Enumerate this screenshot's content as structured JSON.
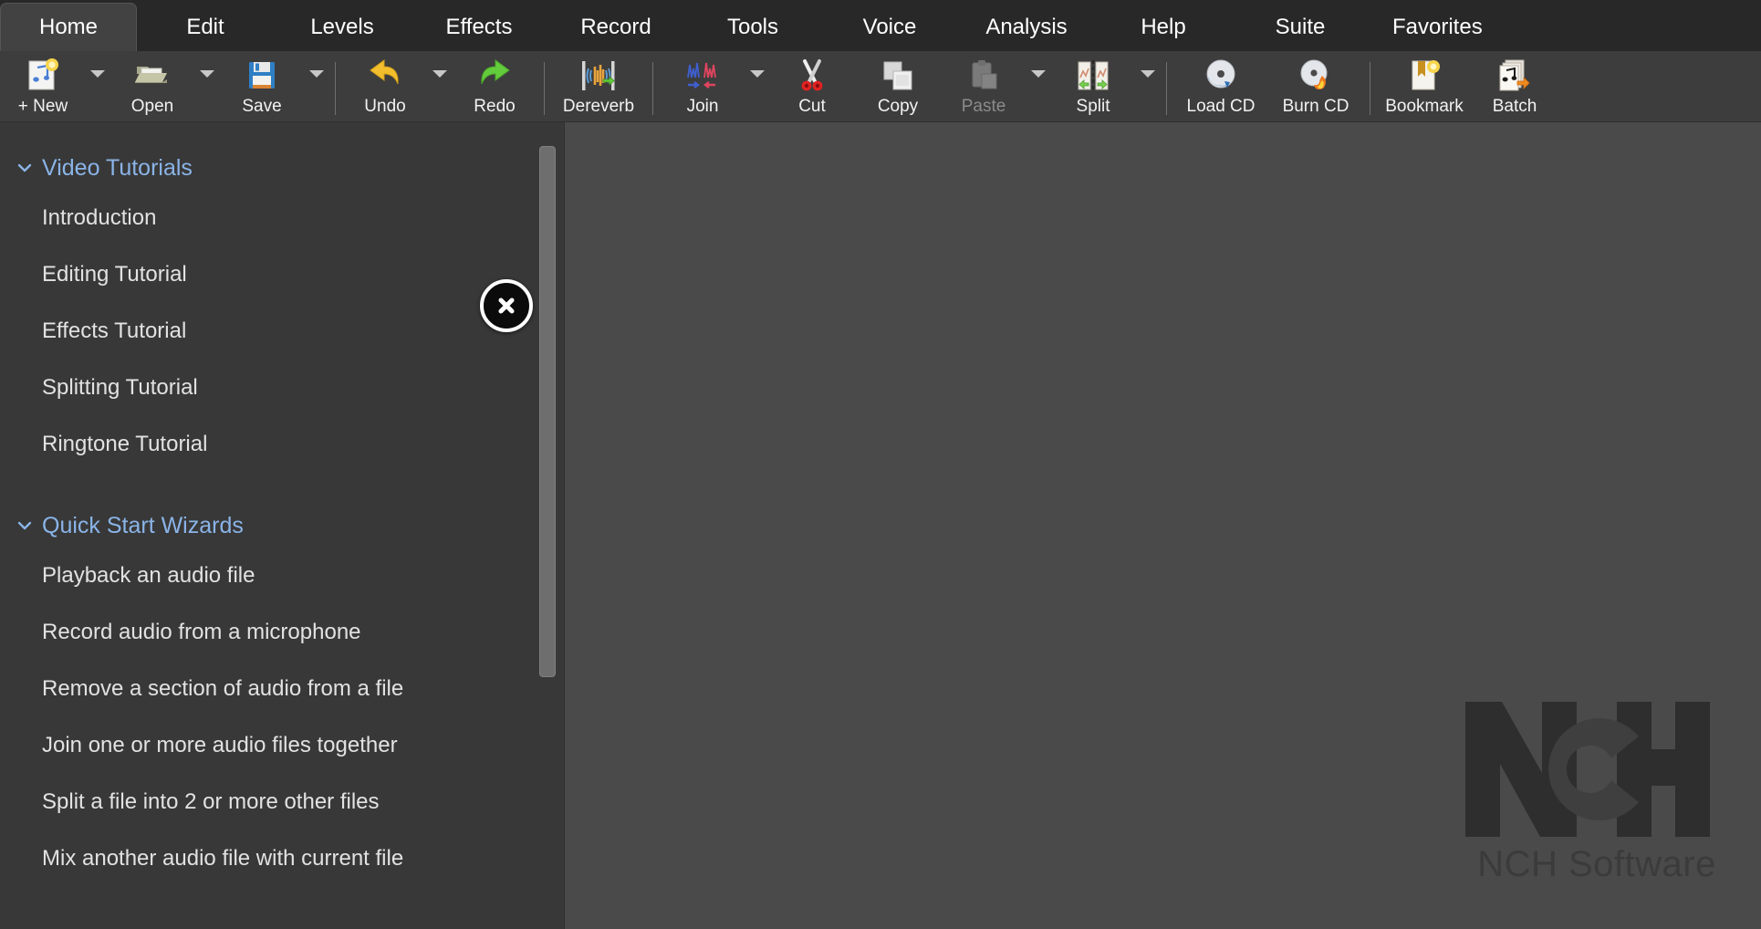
{
  "app": {
    "logo_mark": "NCH",
    "logo_registered": "®",
    "logo_word": "NCH Software"
  },
  "tabs": [
    {
      "label": "Home",
      "active": true
    },
    {
      "label": "Edit",
      "active": false
    },
    {
      "label": "Levels",
      "active": false
    },
    {
      "label": "Effects",
      "active": false
    },
    {
      "label": "Record",
      "active": false
    },
    {
      "label": "Tools",
      "active": false
    },
    {
      "label": "Voice",
      "active": false
    },
    {
      "label": "Analysis",
      "active": false
    },
    {
      "label": "Help",
      "active": false
    },
    {
      "label": "Suite",
      "active": false
    },
    {
      "label": "Favorites",
      "active": false
    }
  ],
  "toolbar": {
    "items": [
      {
        "label": "+ New",
        "icon": "new-file-music-icon",
        "caret": true,
        "disabled": false
      },
      {
        "label": "Open",
        "icon": "open-folder-icon",
        "caret": true,
        "disabled": false
      },
      {
        "label": "Save",
        "icon": "floppy-disk-icon",
        "caret": true,
        "disabled": false
      },
      {
        "label": "Undo",
        "icon": "undo-arrow-icon",
        "caret": true,
        "disabled": false
      },
      {
        "label": "Redo",
        "icon": "redo-arrow-icon",
        "caret": false,
        "disabled": false
      },
      {
        "label": "Dereverb",
        "icon": "dereverb-icon",
        "caret": false,
        "disabled": false
      },
      {
        "label": "Join",
        "icon": "join-waveform-icon",
        "caret": true,
        "disabled": false
      },
      {
        "label": "Cut",
        "icon": "scissors-icon",
        "caret": false,
        "disabled": false
      },
      {
        "label": "Copy",
        "icon": "copy-pages-icon",
        "caret": false,
        "disabled": false
      },
      {
        "label": "Paste",
        "icon": "clipboard-paste-icon",
        "caret": true,
        "disabled": true
      },
      {
        "label": "Split",
        "icon": "split-file-icon",
        "caret": true,
        "disabled": false
      },
      {
        "label": "Load CD",
        "icon": "load-cd-icon",
        "caret": false,
        "disabled": false
      },
      {
        "label": "Burn CD",
        "icon": "burn-cd-icon",
        "caret": false,
        "disabled": false
      },
      {
        "label": "Bookmark",
        "icon": "bookmark-icon",
        "caret": false,
        "disabled": false
      },
      {
        "label": "Batch",
        "icon": "batch-convert-icon",
        "caret": false,
        "disabled": false
      }
    ]
  },
  "sidebar": {
    "close_label": "Close panel",
    "groups": [
      {
        "title": "Video Tutorials",
        "expanded": true,
        "items": [
          "Introduction",
          "Editing Tutorial",
          "Effects Tutorial",
          "Splitting Tutorial",
          "Ringtone Tutorial"
        ]
      },
      {
        "title": "Quick Start Wizards",
        "expanded": true,
        "items": [
          "Playback an audio file",
          "Record audio from a microphone",
          "Remove a section of audio from a file",
          "Join one or more audio files together",
          "Split a file into 2 or more other files",
          "Mix another audio file with current file"
        ]
      }
    ]
  },
  "colors": {
    "tabbar_bg": "#282828",
    "tab_active_bg": "#424242",
    "ribbon_bg": "#3d3d3d",
    "sidebar_bg": "#383838",
    "canvas_bg": "#4a4a4a",
    "group_title": "#8ab4e8",
    "item_text": "#e2e2e2"
  }
}
